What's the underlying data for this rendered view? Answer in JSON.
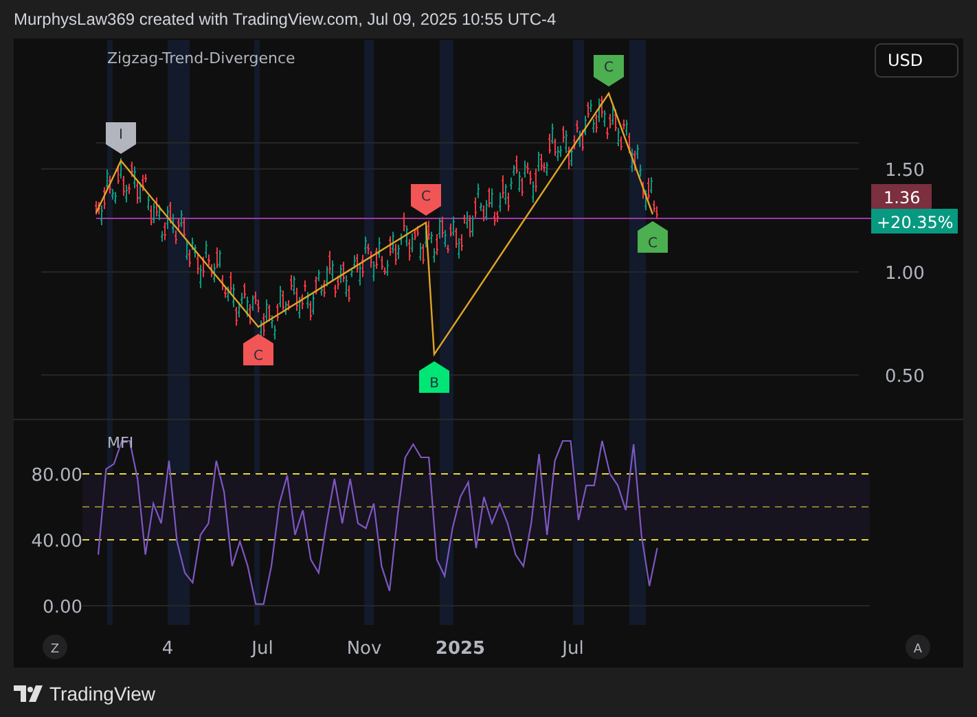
{
  "header": {
    "title": "MurphysLaw369 created with TradingView.com, Jul 09, 2025 10:55 UTC-4"
  },
  "price_pane": {
    "indicator": "Zigzag-Trend-Divergence",
    "currency_button": "USD",
    "axis_labels": [
      "1.50",
      "1.00",
      "0.50"
    ],
    "last_price": "1.36",
    "change": "+20.35%",
    "markers": [
      {
        "label": "I",
        "color": "#b2b5be"
      },
      {
        "label": "C",
        "color": "#f25555"
      },
      {
        "label": "C",
        "color": "#f25555"
      },
      {
        "label": "B",
        "color": "#00e676"
      },
      {
        "label": "C",
        "color": "#4caf50"
      },
      {
        "label": "C",
        "color": "#4caf50"
      }
    ]
  },
  "mfi_pane": {
    "chart_data": {
      "type": "line",
      "ylim": [
        0,
        113
      ],
      "ref_lines": [
        {
          "axis": "y",
          "value": 80,
          "color": "#e8d935"
        },
        {
          "axis": "y",
          "value": 60,
          "color": "#8a7f2a"
        },
        {
          "axis": "y",
          "value": 40,
          "color": "#e8d935"
        }
      ],
      "bands": [
        {
          "axis": "y",
          "from": 40,
          "to": 80,
          "color": "#17131f"
        }
      ],
      "yticks": [
        {
          "value": 80,
          "label": "80.00"
        },
        {
          "value": 40,
          "label": "40.00"
        },
        {
          "value": 0,
          "label": "0.00"
        }
      ],
      "series": [
        {
          "name": "MFI",
          "color": "#7e57c2",
          "values": [
            null,
            null,
            31,
            83,
            86,
            100,
            100,
            77,
            31,
            62,
            50,
            88,
            39,
            20,
            14,
            43,
            50,
            88,
            69,
            24,
            39,
            24,
            1,
            1,
            24,
            62,
            79,
            43,
            58,
            28,
            20,
            50,
            77,
            50,
            77,
            50,
            47,
            62,
            24,
            9,
            54,
            90,
            98,
            90,
            90,
            28,
            18,
            47,
            66,
            75,
            35,
            66,
            50,
            62,
            50,
            31,
            24,
            50,
            92,
            43,
            88,
            100,
            100,
            52,
            73,
            73,
            100,
            80,
            73,
            58,
            98,
            43,
            12,
            35,
            null,
            null,
            null,
            null,
            null,
            null,
            null,
            null,
            null,
            null,
            null,
            null,
            null,
            null,
            null,
            null,
            null,
            null,
            null,
            null,
            null,
            null,
            null,
            null,
            null,
            null,
            null
          ]
        }
      ]
    }
  },
  "time_axis": {
    "labels": [
      {
        "text": "4",
        "bold": false
      },
      {
        "text": "Jul",
        "bold": false
      },
      {
        "text": "Nov",
        "bold": false
      },
      {
        "text": "2025",
        "bold": true
      },
      {
        "text": "Jul",
        "bold": false
      }
    ],
    "left_button": "Z",
    "right_button": "A"
  },
  "footer": {
    "brand": "TradingView"
  }
}
